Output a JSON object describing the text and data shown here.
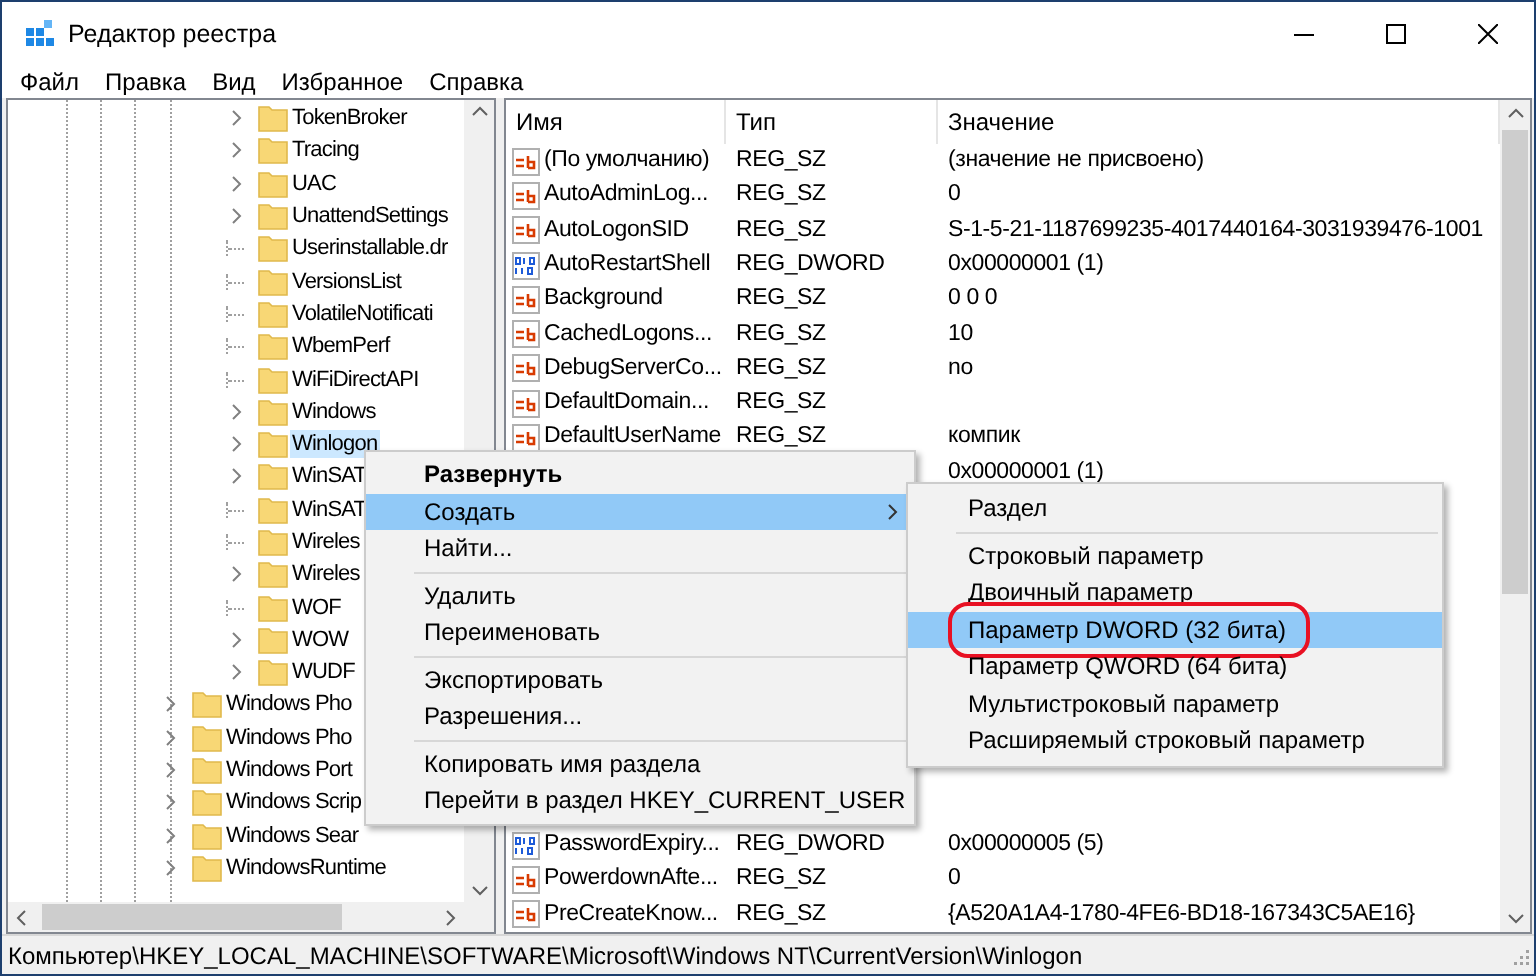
{
  "window": {
    "title": "Редактор реестра"
  },
  "menu_bar": [
    "Файл",
    "Правка",
    "Вид",
    "Избранное",
    "Справка"
  ],
  "tree": {
    "items": [
      {
        "children": [
          {
            "label": "TokenBroker",
            "expandable": true,
            "selected": false
          },
          {
            "label": "Tracing",
            "expandable": true,
            "selected": false
          },
          {
            "label": "UAC",
            "expandable": true,
            "selected": false
          },
          {
            "label": "UnattendSettings",
            "expandable": true,
            "selected": false
          },
          {
            "label": "Userinstallable.dr",
            "expandable": false,
            "selected": false
          },
          {
            "label": "VersionsList",
            "expandable": false,
            "selected": false
          },
          {
            "label": "VolatileNotificati",
            "expandable": false,
            "selected": false
          },
          {
            "label": "WbemPerf",
            "expandable": false,
            "selected": false
          },
          {
            "label": "WiFiDirectAPI",
            "expandable": false,
            "selected": false
          },
          {
            "label": "Windows",
            "expandable": true,
            "selected": false
          },
          {
            "label": "Winlogon",
            "expandable": true,
            "selected": true
          },
          {
            "label": "WinSAT",
            "expandable": true,
            "selected": false
          },
          {
            "label": "WinSAT",
            "expandable": false,
            "selected": false
          },
          {
            "label": "Wireles",
            "expandable": false,
            "selected": false
          },
          {
            "label": "Wireles",
            "expandable": true,
            "selected": false
          },
          {
            "label": "WOF",
            "expandable": false,
            "selected": false
          },
          {
            "label": "WOW",
            "expandable": true,
            "selected": false
          },
          {
            "label": "WUDF",
            "expandable": true,
            "selected": false
          }
        ]
      },
      {
        "label": "Windows Pho",
        "expandable": true,
        "selected": false
      },
      {
        "label": "Windows Pho",
        "expandable": true,
        "selected": false
      },
      {
        "label": "Windows Port",
        "expandable": true,
        "selected": false
      },
      {
        "label": "Windows Scrip",
        "expandable": true,
        "selected": false
      },
      {
        "label": "Windows Sear",
        "expandable": true,
        "selected": false
      },
      {
        "label": "WindowsRuntime",
        "expandable": true,
        "selected": false
      }
    ]
  },
  "values": {
    "columns": [
      "Имя",
      "Тип",
      "Значение"
    ],
    "rows": [
      {
        "kind": "string",
        "name": "(По умолчанию)",
        "type": "REG_SZ",
        "value": "(значение не присвоено)"
      },
      {
        "kind": "string",
        "name": "AutoAdminLog...",
        "type": "REG_SZ",
        "value": "0"
      },
      {
        "kind": "string",
        "name": "AutoLogonSID",
        "type": "REG_SZ",
        "value": "S-1-5-21-1187699235-4017440164-3031939476-1001"
      },
      {
        "kind": "dword",
        "name": "AutoRestartShell",
        "type": "REG_DWORD",
        "value": "0x00000001 (1)"
      },
      {
        "kind": "string",
        "name": "Background",
        "type": "REG_SZ",
        "value": "0 0 0"
      },
      {
        "kind": "string",
        "name": "CachedLogons...",
        "type": "REG_SZ",
        "value": "10"
      },
      {
        "kind": "string",
        "name": "DebugServerCo...",
        "type": "REG_SZ",
        "value": "no"
      },
      {
        "kind": "string",
        "name": "DefaultDomain...",
        "type": "REG_SZ"
      },
      {
        "kind": "string",
        "name": "DefaultUserName",
        "type": "REG_SZ",
        "value": "компик"
      },
      {
        "value": "0x00000001 (1)"
      },
      {
        "kind": "dword",
        "name": "PasswordExpiry...",
        "type": "REG_DWORD",
        "value": "0x00000005 (5)"
      },
      {
        "kind": "string",
        "name": "PowerdownAfte...",
        "type": "REG_SZ",
        "value": "0"
      },
      {
        "kind": "string",
        "name": "PreCreateKnow...",
        "type": "REG_SZ",
        "value": "{A520A1A4-1780-4FE6-BD18-167343C5AE16}"
      }
    ]
  },
  "context_menu": {
    "items": [
      {
        "kind": "item",
        "label": "Развернуть",
        "default": true,
        "selected": false,
        "submenu": false
      },
      {
        "kind": "item",
        "label": "Создать",
        "default": false,
        "selected": true,
        "submenu": true
      },
      {
        "kind": "item",
        "label": "Найти...",
        "default": false,
        "selected": false,
        "submenu": false
      },
      {
        "kind": "separator"
      },
      {
        "kind": "item",
        "label": "Удалить",
        "default": false,
        "selected": false,
        "submenu": false
      },
      {
        "kind": "item",
        "label": "Переименовать",
        "default": false,
        "selected": false,
        "submenu": false
      },
      {
        "kind": "separator"
      },
      {
        "kind": "item",
        "label": "Экспортировать",
        "default": false,
        "selected": false,
        "submenu": false
      },
      {
        "kind": "item",
        "label": "Разрешения...",
        "default": false,
        "selected": false,
        "submenu": false
      },
      {
        "kind": "separator"
      },
      {
        "kind": "item",
        "label": "Копировать имя раздела",
        "default": false,
        "selected": false,
        "submenu": false
      },
      {
        "kind": "item",
        "label": "Перейти в раздел HKEY_CURRENT_USER",
        "default": false,
        "selected": false,
        "submenu": false
      }
    ]
  },
  "submenu": {
    "items": [
      {
        "kind": "item",
        "label": "Раздел",
        "selected": false,
        "highlighted": false
      },
      {
        "kind": "separator"
      },
      {
        "kind": "item",
        "label": "Строковый параметр",
        "selected": false,
        "highlighted": false
      },
      {
        "kind": "item",
        "label": "Двоичный параметр",
        "selected": false,
        "highlighted": false
      },
      {
        "kind": "item",
        "label": "Параметр DWORD (32 бита)",
        "selected": true,
        "highlighted": true
      },
      {
        "kind": "item",
        "label": "Параметр QWORD (64 бита)",
        "selected": false,
        "highlighted": false
      },
      {
        "kind": "item",
        "label": "Мультистроковый параметр",
        "selected": false,
        "highlighted": false
      },
      {
        "kind": "item",
        "label": "Расширяемый строковый параметр",
        "selected": false,
        "highlighted": false
      }
    ]
  },
  "status_bar": "Компьютер\\HKEY_LOCAL_MACHINE\\SOFTWARE\\Microsoft\\Windows NT\\CurrentVersion\\Winlogon"
}
